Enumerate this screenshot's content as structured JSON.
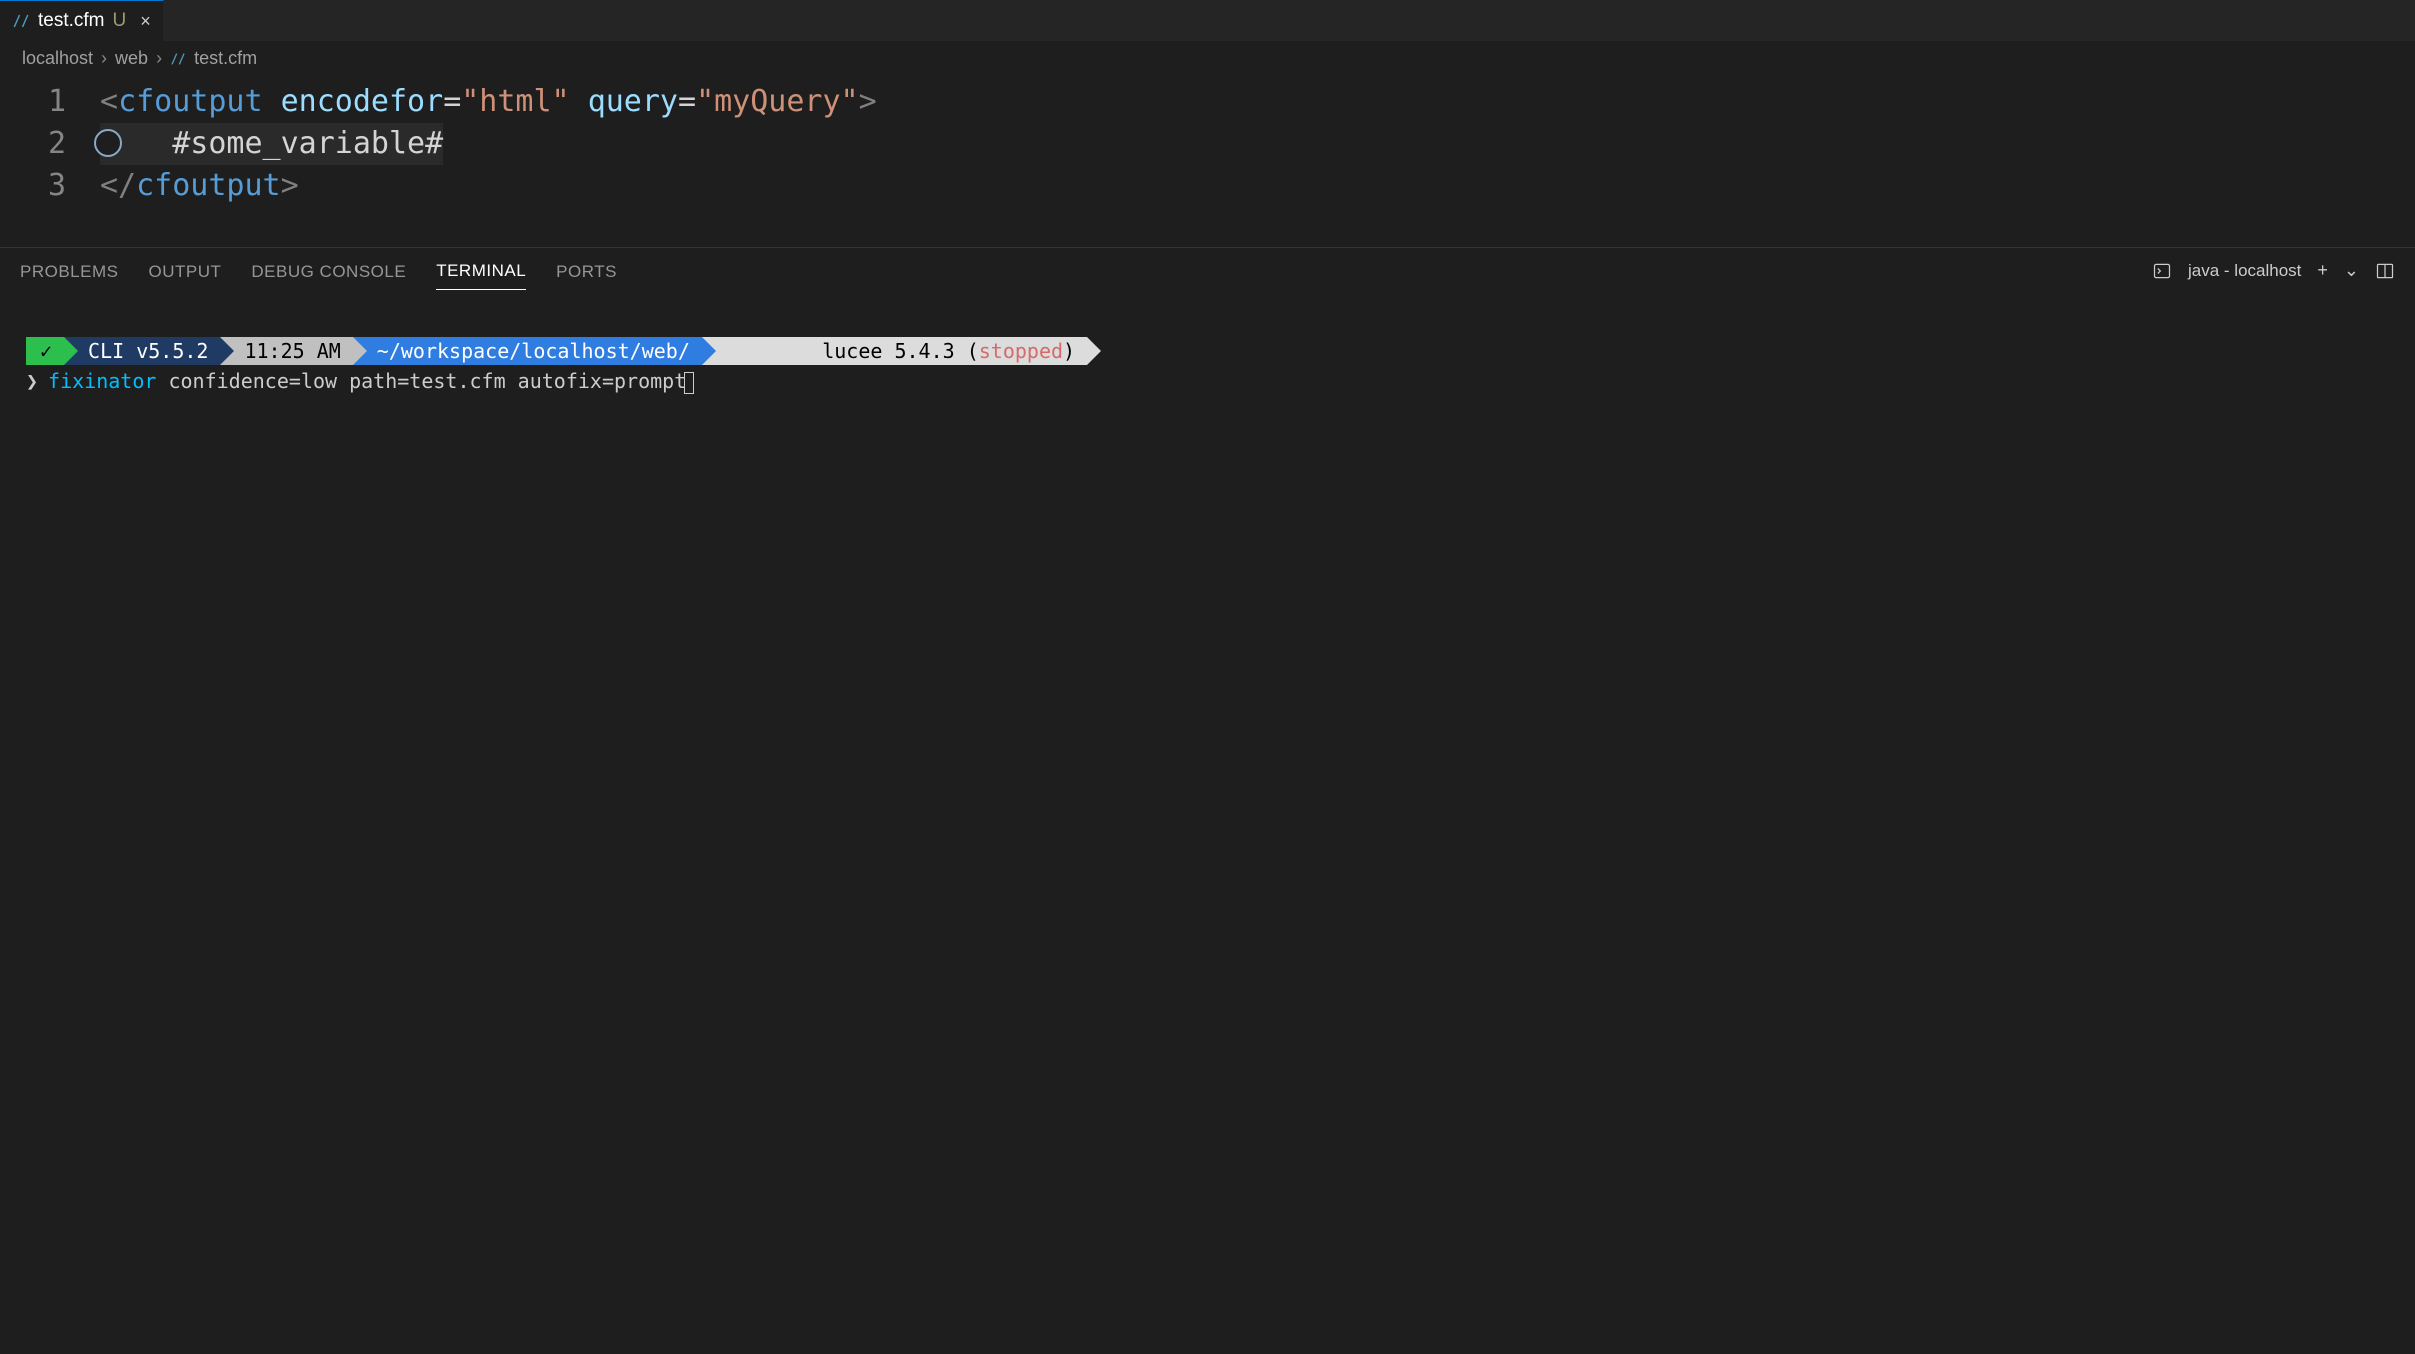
{
  "tab": {
    "filename": "test.cfm",
    "modified_marker": "U",
    "close_glyph": "×"
  },
  "breadcrumb": {
    "segments": [
      "localhost",
      "web",
      "test.cfm"
    ]
  },
  "editor": {
    "lines": [
      {
        "num": "1",
        "tokens": [
          {
            "t": "<",
            "cls": "tok-bracket"
          },
          {
            "t": "cfoutput",
            "cls": "tok-tag"
          },
          {
            "t": " ",
            "cls": "tok-plain"
          },
          {
            "t": "encodefor",
            "cls": "tok-attr"
          },
          {
            "t": "=",
            "cls": "tok-op"
          },
          {
            "t": "\"html\"",
            "cls": "tok-str"
          },
          {
            "t": " ",
            "cls": "tok-plain"
          },
          {
            "t": "query",
            "cls": "tok-attr"
          },
          {
            "t": "=",
            "cls": "tok-op"
          },
          {
            "t": "\"myQuery\"",
            "cls": "tok-str"
          },
          {
            "t": ">",
            "cls": "tok-bracket"
          }
        ]
      },
      {
        "num": "2",
        "current": true,
        "bulb": true,
        "tokens": [
          {
            "t": "    #some_variable#",
            "cls": "tok-plain"
          }
        ]
      },
      {
        "num": "3",
        "tokens": [
          {
            "t": "</",
            "cls": "tok-bracket"
          },
          {
            "t": "cfoutput",
            "cls": "tok-tag"
          },
          {
            "t": ">",
            "cls": "tok-bracket"
          }
        ]
      }
    ]
  },
  "panel": {
    "tabs": [
      "PROBLEMS",
      "OUTPUT",
      "DEBUG CONSOLE",
      "TERMINAL",
      "PORTS"
    ],
    "active_tab": "TERMINAL",
    "right": {
      "shell_label": "java - localhost",
      "plus": "+",
      "chevron": "⌄"
    }
  },
  "terminal": {
    "powerline": {
      "check": "✓",
      "cli": "CLI v5.5.2",
      "time": "11:25 AM",
      "path": "~/workspace/localhost/web/",
      "engine_prefix": "lucee 5.4.3 (",
      "engine_state": "stopped",
      "engine_suffix": ")"
    },
    "prompt": "❯",
    "command": "fixinator",
    "args": "confidence=low path=test.cfm autofix=prompt"
  }
}
